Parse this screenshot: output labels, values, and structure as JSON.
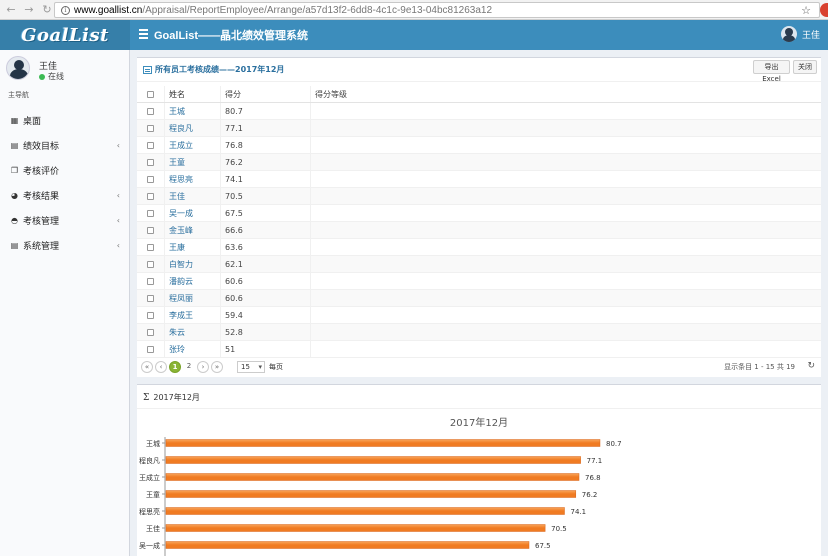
{
  "browser": {
    "url_host": "www.goallist.cn",
    "url_path": "/Appraisal/ReportEmployee/Arrange/a57d13f2-6dd8-4c1c-9e13-04bc81263a12"
  },
  "header": {
    "logo_text": "GoalList",
    "system_title": "GoalList——晶北绩效管理系统",
    "user_name": "王佳"
  },
  "sidebar": {
    "user_name": "王佳",
    "status": "在线",
    "nav_header": "主导航",
    "items": [
      {
        "label": "桌面",
        "icon": "grid-icon",
        "glyph": "▦",
        "has_children": false
      },
      {
        "label": "绩效目标",
        "icon": "book-icon",
        "glyph": "▤",
        "has_children": true
      },
      {
        "label": "考核评价",
        "icon": "copy-icon",
        "glyph": "❐",
        "has_children": false
      },
      {
        "label": "考核结果",
        "icon": "pie-chart-icon",
        "glyph": "◕",
        "has_children": true
      },
      {
        "label": "考核管理",
        "icon": "dashboard-icon",
        "glyph": "◓",
        "has_children": true
      },
      {
        "label": "系统管理",
        "icon": "book-icon",
        "glyph": "▤",
        "has_children": true
      }
    ]
  },
  "report": {
    "title": "所有员工考核成绩——2017年12月",
    "export_label": "导出Excel",
    "close_label": "关闭",
    "columns": [
      "姓名",
      "得分",
      "得分等级"
    ],
    "rows": [
      {
        "name": "王城",
        "score": "80.7",
        "grade": ""
      },
      {
        "name": "程良凡",
        "score": "77.1",
        "grade": ""
      },
      {
        "name": "王成立",
        "score": "76.8",
        "grade": ""
      },
      {
        "name": "王童",
        "score": "76.2",
        "grade": ""
      },
      {
        "name": "程思亮",
        "score": "74.1",
        "grade": ""
      },
      {
        "name": "王佳",
        "score": "70.5",
        "grade": ""
      },
      {
        "name": "吴一成",
        "score": "67.5",
        "grade": ""
      },
      {
        "name": "金玉峰",
        "score": "66.6",
        "grade": ""
      },
      {
        "name": "王康",
        "score": "63.6",
        "grade": ""
      },
      {
        "name": "白智力",
        "score": "62.1",
        "grade": ""
      },
      {
        "name": "潘韵云",
        "score": "60.6",
        "grade": ""
      },
      {
        "name": "程凤丽",
        "score": "60.6",
        "grade": ""
      },
      {
        "name": "李成王",
        "score": "59.4",
        "grade": ""
      },
      {
        "name": "朱云",
        "score": "52.8",
        "grade": ""
      },
      {
        "name": "张玲",
        "score": "51",
        "grade": ""
      }
    ],
    "pager": {
      "pages": [
        "1",
        "2"
      ],
      "current_page": "1",
      "page_size": "15",
      "per_page_label": "每页",
      "info": "显示条目 1 - 15 共 19"
    }
  },
  "chart_section": {
    "header_title": "2017年12月"
  },
  "chart_data": {
    "type": "bar",
    "orientation": "horizontal",
    "title": "2017年12月",
    "categories": [
      "王城",
      "程良凡",
      "王成立",
      "王童",
      "程思亮",
      "王佳",
      "吴一成"
    ],
    "values": [
      80.7,
      77.1,
      76.8,
      76.2,
      74.1,
      70.5,
      67.5
    ],
    "xlim": [
      0,
      90
    ],
    "bar_color": "#f07b22",
    "bar_color_light": "#f9a55a",
    "grid": false
  }
}
